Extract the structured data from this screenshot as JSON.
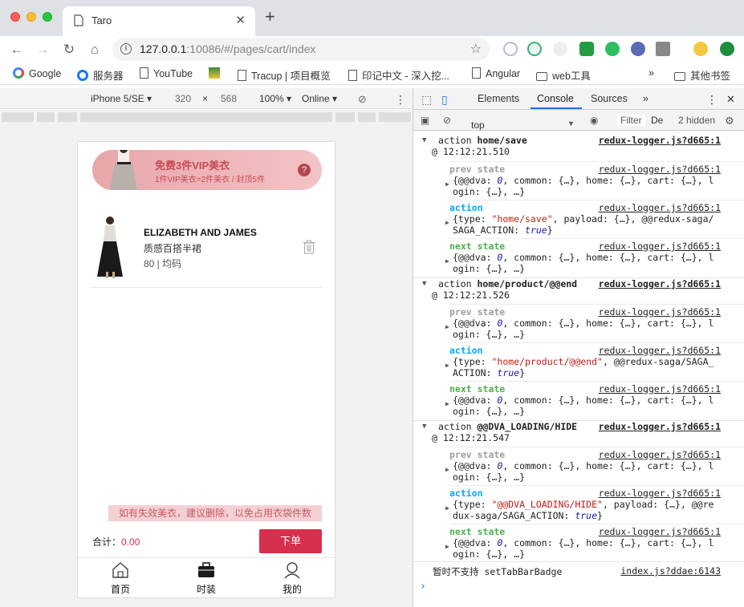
{
  "browser": {
    "tab_title": "Taro",
    "url_host": "127.0.0.1",
    "url_rest": ":10086/#/pages/cart/index"
  },
  "bookmarks": [
    {
      "label": "Google"
    },
    {
      "label": "服务器"
    },
    {
      "label": "YouTube"
    },
    {
      "label": ""
    },
    {
      "label": "Tracup | 项目概览"
    },
    {
      "label": "印记中文 - 深入挖..."
    },
    {
      "label": "Angular"
    },
    {
      "label": "web工具"
    },
    {
      "label": "»"
    },
    {
      "label": "其他书签"
    }
  ],
  "device": {
    "model": "iPhone 5/SE ▾",
    "width": "320",
    "times": "×",
    "height": "568",
    "zoom": "100% ▾",
    "network": "Online ▾"
  },
  "app": {
    "vip_title": "免费3件VIP美衣",
    "vip_sub": "1件VIP美衣=2件美衣 / 封顶5件",
    "vip_help": "?",
    "item": {
      "brand": "ELIZABETH AND JAMES",
      "name": "质感百搭半裙",
      "size": "80 | 均码"
    },
    "notice": "如有失效美衣，建议删除，以免占用衣袋件数",
    "total_label": "合计：",
    "total_value": "0.00",
    "order_button": "下单",
    "tabs": [
      {
        "label": "首页"
      },
      {
        "label": "时装"
      },
      {
        "label": "我的"
      }
    ]
  },
  "devtools": {
    "tabs": [
      "Elements",
      "Console",
      "Sources",
      "»"
    ],
    "active_tab": "Console",
    "context": "top",
    "filter_placeholder": "Filter",
    "levels": "De",
    "hidden": "2 hidden",
    "groups": [
      {
        "action": "action ",
        "type": "home/save",
        "time": "@ 12:12:21.510",
        "source": "redux-logger.js?d665:1",
        "prev_label": "prev state",
        "prev_body": "{@@dva: 0, common: {…}, home: {…}, cart: {…}, l\nogin: {…}, …}",
        "action_label": "action",
        "action_body": "{type: \"home/save\", payload: {…}, @@redux-saga/\nSAGA_ACTION: true}",
        "next_label": "next state",
        "next_body": "{@@dva: 0, common: {…}, home: {…}, cart: {…}, l\nogin: {…}, …}"
      },
      {
        "action": "action ",
        "type": "home/product/@@end",
        "time": "@ 12:12:21.526",
        "source": "redux-logger.js?d665:1",
        "prev_label": "prev state",
        "prev_body": "{@@dva: 0, common: {…}, home: {…}, cart: {…}, l\nogin: {…}, …}",
        "action_label": "action",
        "action_body": "{type: \"home/product/@@end\", @@redux-saga/SAGA_\nACTION: true}",
        "next_label": "next state",
        "next_body": "{@@dva: 0, common: {…}, home: {…}, cart: {…}, l\nogin: {…}, …}"
      },
      {
        "action": "action ",
        "type": "@@DVA_LOADING/HIDE",
        "time": "@ 12:12:21.547",
        "source": "redux-logger.js?d665:1",
        "prev_label": "prev state",
        "prev_body": "{@@dva: 0, common: {…}, home: {…}, cart: {…}, l\nogin: {…}, …}",
        "action_label": "action",
        "action_body": "{type: \"@@DVA_LOADING/HIDE\", payload: {…}, @@re\ndux-saga/SAGA_ACTION: true}",
        "next_label": "next state",
        "next_body": "{@@dva: 0, common: {…}, home: {…}, cart: {…}, l\nogin: {…}, …}"
      }
    ],
    "warn_message": "暂时不支持 setTabBarBadge",
    "warn_source": "index.js?ddae:6143",
    "prompt": "›"
  },
  "colors": {
    "accent": "#d6304c",
    "devtools_action": "#03a9f4",
    "devtools_next": "#4caf50",
    "devtools_prev": "#9e9e9e"
  }
}
